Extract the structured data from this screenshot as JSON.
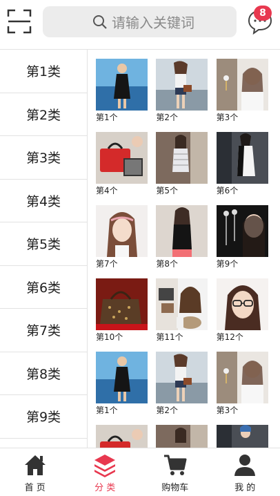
{
  "header": {
    "scan_icon": "scan-icon",
    "search_placeholder": "请输入关键词",
    "message_icon": "message-icon",
    "message_count": "8"
  },
  "sidebar": {
    "items": [
      "第1类",
      "第2类",
      "第3类",
      "第4类",
      "第5类",
      "第6类",
      "第7类",
      "第8类",
      "第9类"
    ]
  },
  "grid": {
    "items": [
      {
        "label": "第1个",
        "photo": "woman-black-dress-beach"
      },
      {
        "label": "第2个",
        "photo": "woman-shorts-handbag"
      },
      {
        "label": "第3个",
        "photo": "woman-earrings"
      },
      {
        "label": "第4个",
        "photo": "red-handbag"
      },
      {
        "label": "第5个",
        "photo": "woman-striped-dress"
      },
      {
        "label": "第6个",
        "photo": "woman-black-white-dress"
      },
      {
        "label": "第7个",
        "photo": "woman-headband-portrait"
      },
      {
        "label": "第8个",
        "photo": "woman-black-top"
      },
      {
        "label": "第9个",
        "photo": "drop-earrings"
      },
      {
        "label": "第10个",
        "photo": "monogram-bag"
      },
      {
        "label": "第11个",
        "photo": "backpacks"
      },
      {
        "label": "第12个",
        "photo": "woman-glasses"
      },
      {
        "label": "第1个",
        "photo": "woman-black-dress-beach"
      },
      {
        "label": "第2个",
        "photo": "woman-shorts-handbag"
      },
      {
        "label": "第3个",
        "photo": "woman-earrings"
      },
      {
        "label": "",
        "photo": "red-handbag"
      },
      {
        "label": "",
        "photo": "woman-striped-dress"
      },
      {
        "label": "",
        "photo": "woman-black-white-dress"
      }
    ]
  },
  "tabbar": {
    "items": [
      {
        "label": "首 页",
        "icon": "home-icon",
        "active": false
      },
      {
        "label": "分 类",
        "icon": "category-layers-icon",
        "active": true
      },
      {
        "label": "购物车",
        "icon": "cart-icon",
        "active": false
      },
      {
        "label": "我 的",
        "icon": "user-icon",
        "active": false
      }
    ]
  },
  "colors": {
    "accent": "#e8384f",
    "icon_dark": "#333333",
    "search_bg": "#ececec",
    "border": "#e2e2e2"
  }
}
